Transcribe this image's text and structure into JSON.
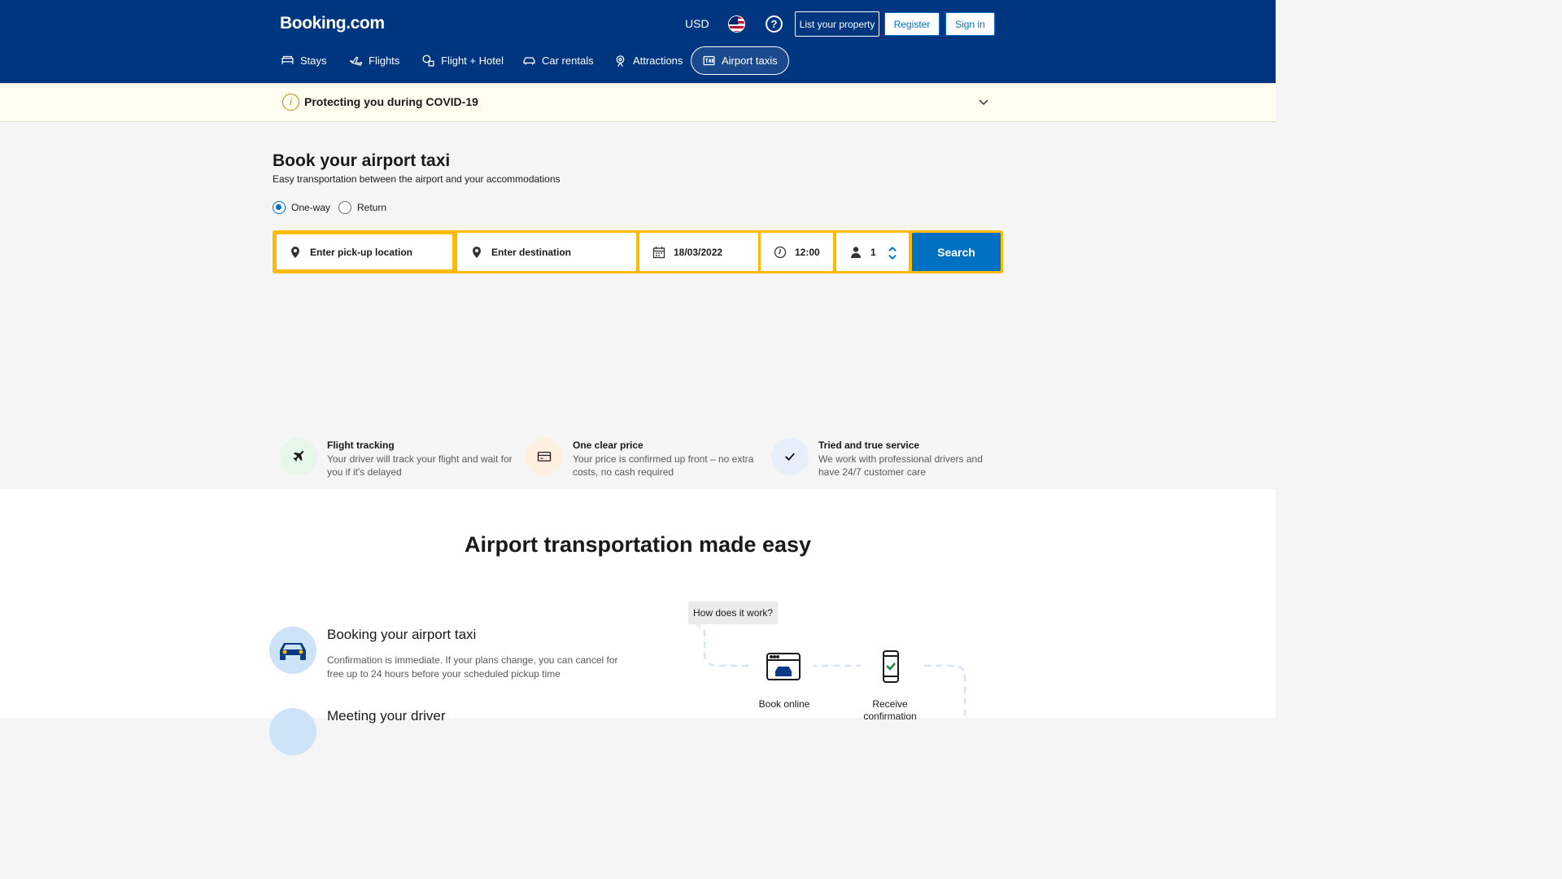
{
  "header": {
    "logo": "Booking.com",
    "currency": "USD",
    "help": "?",
    "list_property": "List your property",
    "register": "Register",
    "sign_in": "Sign in",
    "nav": [
      {
        "label": "Stays",
        "icon": "bed-icon"
      },
      {
        "label": "Flights",
        "icon": "plane-icon"
      },
      {
        "label": "Flight + Hotel",
        "icon": "flight-hotel-icon"
      },
      {
        "label": "Car rentals",
        "icon": "car-icon"
      },
      {
        "label": "Attractions",
        "icon": "attractions-icon"
      },
      {
        "label": "Airport taxis",
        "icon": "taxi-icon",
        "active": true
      }
    ]
  },
  "covid": {
    "text": "Protecting you during COVID-19",
    "info": "i"
  },
  "hero": {
    "title": "Book your airport taxi",
    "subtitle": "Easy transportation between the airport and your accommodations",
    "trip_options": [
      {
        "label": "One-way",
        "selected": true
      },
      {
        "label": "Return",
        "selected": false
      }
    ]
  },
  "search": {
    "pickup_placeholder": "Enter pick-up location",
    "destination_placeholder": "Enter destination",
    "date": "18/03/2022",
    "time": "12:00",
    "passengers": "1",
    "button": "Search"
  },
  "features": [
    {
      "title": "Flight tracking",
      "desc": "Your driver will track your flight and wait for you if it's delayed",
      "icon": "plane-icon",
      "bg": "#e6f7ea"
    },
    {
      "title": "One clear price",
      "desc": "Your price is confirmed up front – no extra costs, no cash required",
      "icon": "credit-card-icon",
      "bg": "#fdf0e0"
    },
    {
      "title": "Tried and true service",
      "desc": "We work with professional drivers and have 24/7 customer care",
      "icon": "checkmark-icon",
      "bg": "#e8effa"
    }
  ],
  "section": {
    "title": "Airport transportation made easy",
    "steps": [
      {
        "title": "Booking your airport taxi",
        "desc": "Confirmation is immediate. If your plans change, you can cancel for free up to 24 hours before your scheduled pickup time"
      },
      {
        "title": "Meeting your driver",
        "desc": ""
      }
    ],
    "how_it_works": "How does it work?",
    "diagram": [
      {
        "label": "Book online"
      },
      {
        "label": "Receive confirmation"
      }
    ]
  },
  "colors": {
    "brand": "#003580",
    "accent": "#0071c2",
    "search_border": "#febb02"
  }
}
